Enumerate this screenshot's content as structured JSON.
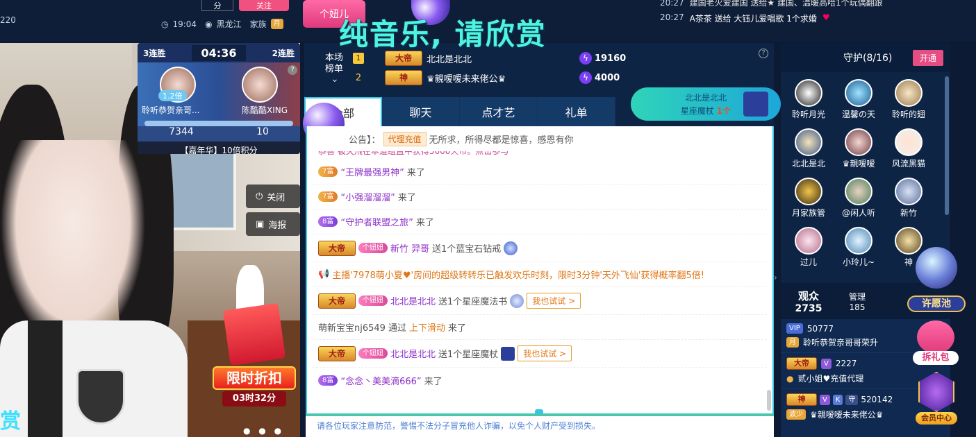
{
  "topbar": {
    "left_num": "220",
    "time": "19:04",
    "location": "黑龙江",
    "family_label": "家族",
    "family_badge": "月",
    "btn_left": "分",
    "btn_right": "关注",
    "feed": [
      {
        "time": "20:27",
        "text": "建国老火爱建国 送给★ 建国、温暖高哈1个玩偶翻跟"
      },
      {
        "time": "20:27",
        "text": "A茶茶 送给 大钰儿爱唱歌 1个求婚"
      }
    ]
  },
  "banner": {
    "text": "纯音乐, 请欣赏",
    "sister_badge": "个妞儿"
  },
  "pk": {
    "left_streak": "3连胜",
    "timer": "04:36",
    "right_streak": "2连胜",
    "multiplier": "1.2倍",
    "left_name": "聆听恭贺亲哥...",
    "right_name": "陈酷酷XING",
    "left_score": "7344",
    "right_score": "10",
    "footer": "【嘉年华】10倍积分",
    "help": "?"
  },
  "video_buttons": {
    "close": "关闭",
    "poster": "海报"
  },
  "promo": {
    "title": "限时折扣",
    "countdown": "03时32分"
  },
  "rank": {
    "label": "本场榜单",
    "rows": [
      {
        "no": "1",
        "title": "大帝",
        "name": "北北是北北",
        "score": "19160"
      },
      {
        "no": "2",
        "title": "神",
        "name": "♛親嗳嗳未来佬公♛",
        "score": "4000"
      }
    ]
  },
  "tabs": [
    {
      "label": "全部",
      "active": true
    },
    {
      "label": "聊天",
      "active": false
    },
    {
      "label": "点才艺",
      "active": false
    },
    {
      "label": "礼单",
      "active": false
    }
  ],
  "gift_popup": {
    "user": "北北是北北",
    "gift": "星座魔杖",
    "count": "1个"
  },
  "chat": {
    "announcement_prefix": "公告】：",
    "announcement_tag": "代理充值",
    "announcement_text": "无所求，所得尽都是惊喜，感恩有你",
    "partial_line": "恭喜 被灭飛在本道组直中获得5000火币。点击参与",
    "messages": [
      {
        "type": "enter",
        "lvl": "7富",
        "lvlclass": "lvl7",
        "user": "“王牌最强男神”",
        "suffix": "来了"
      },
      {
        "type": "enter",
        "lvl": "7富",
        "lvlclass": "lvl7",
        "user": "“小强溜溜溜”",
        "suffix": "来了"
      },
      {
        "type": "enter",
        "lvl": "8富",
        "lvlclass": "lvl8",
        "user": "“守护者联盟之旅”",
        "suffix": "来了"
      }
    ],
    "gift1": {
      "title": "大帝",
      "sister": "个妞妞",
      "user1": "新竹",
      "user2": "羿哥",
      "text": "送1个蓝宝石钻戒"
    },
    "system": "主播'7978萌小夏♥'房间的超级转转乐已触发欢乐时刻，限时3分钟'天外飞仙'获得概率翻5倍!",
    "gift2": {
      "title": "大帝",
      "sister": "个妞妞",
      "user": "北北是北北",
      "text": "送1个星座魔法书",
      "btn": "我也试试 >"
    },
    "newbie": {
      "name": "萌新宝宝nj6549",
      "mid": "通过",
      "action": "上下滑动",
      "suffix": "来了"
    },
    "gift3": {
      "title": "大帝",
      "sister": "个妞妞",
      "user": "北北是北北",
      "text": "送1个星座魔杖",
      "btn": "我也试试 >"
    },
    "last": {
      "lvl": "8富",
      "user": "“念念丶美美滴666”",
      "suffix": "来了"
    }
  },
  "notice": "请各位玩家注意防范，警惕不法分子冒充他人诈骗，以免个人财产受到损失。",
  "guard": {
    "title": "守护(8/16)",
    "open_btn": "开通",
    "members": [
      "聆听月光",
      "温馨の天",
      "聆听的翅",
      "北北是北",
      "♛親嗳嗳",
      "风流黑猫",
      "月家族管",
      "@闲人听",
      "新竹",
      "过儿",
      "小玲儿~",
      "神"
    ]
  },
  "audience": {
    "label": "观众",
    "count": "2735",
    "manage_label": "管理",
    "manage_count": "185",
    "wish_pool": "许愿池"
  },
  "users": [
    {
      "id": "50777",
      "line2_badge": "月",
      "line2": "聆听恭贺亲哥哥荣升"
    },
    {
      "title": "大帝",
      "badge_v": "V",
      "id": "2227",
      "line2": "贰小姐♥充值代理"
    },
    {
      "title": "神",
      "badge_v": "V",
      "badge_k": "K",
      "badge_s": "守",
      "id": "520142",
      "line2": "♛親嗳嗳未来佬公♛",
      "line2_badge": "波少"
    }
  ],
  "side_widgets": {
    "gift_pack": "拆礼包",
    "member_center": "会员中心"
  }
}
